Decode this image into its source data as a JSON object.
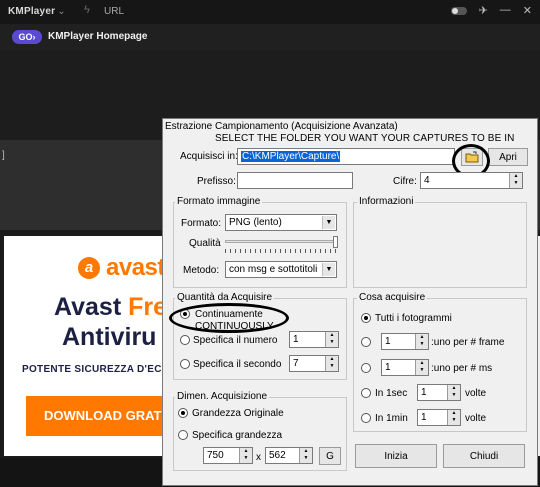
{
  "app": {
    "name": "KMPlayer",
    "url_label": "URL",
    "go_label": "GO",
    "page_title": "KMPlayer Homepage"
  },
  "ad": {
    "brand": "avast",
    "headline_part1": "Avast ",
    "headline_accent": "Fre",
    "headline_line2": "Antiviru",
    "tagline": "POTENTE SICUREZZA D'EC",
    "cta": "DOWNLOAD GRAT"
  },
  "dialog": {
    "title": "Estrazione Campionamento (Acquisizione Avanzata)",
    "instruction": "SELECT THE FOLDER YOU WANT YOUR CAPTURES TO BE IN",
    "acquire_label": "Acquisisci in:",
    "acquire_path": "C:\\KMPlayer\\Capture\\",
    "open_button": "Apri",
    "prefix_label": "Prefisso:",
    "prefix_value": "",
    "digits_label": "Cifre:",
    "digits_value": "4",
    "format_group": {
      "title": "Formato immagine",
      "format_label": "Formato:",
      "format_value": "PNG (lento)",
      "quality_label": "Qualità",
      "quality_level": 1.0,
      "method_label": "Metodo:",
      "method_value": "con msg e sottotitoli"
    },
    "info_group": {
      "title": "Informazioni"
    },
    "quantity_group": {
      "title": "Quantità da Acquisire",
      "continuous_label": "Continuamente",
      "continuous_annotation": "CONTINUOUSLY",
      "specify_number_label": "Specifica il numero",
      "specify_number_value": "1",
      "specify_second_label": "Specifica il secondo",
      "specify_second_value": "7"
    },
    "what_group": {
      "title": "Cosa acquisire",
      "all_frames_label": "Tutti i fotogrammi",
      "per_frame_value": "1",
      "per_frame_label": ":uno per # frame",
      "per_ms_value": "1",
      "per_ms_label": ":uno per # ms",
      "in_1sec_label": "In 1sec",
      "in_1sec_value": "1",
      "in_1sec_unit": "volte",
      "in_1min_label": "In 1min",
      "in_1min_value": "1",
      "in_1min_unit": "volte"
    },
    "size_group": {
      "title": "Dimen. Acquisizione",
      "original_label": "Grandezza Originale",
      "specify_label": "Specifica grandezza",
      "width_value": "750",
      "times": "x",
      "height_value": "562",
      "g_button": "G"
    },
    "start_button": "Inizia",
    "close_button": "Chiudi"
  }
}
